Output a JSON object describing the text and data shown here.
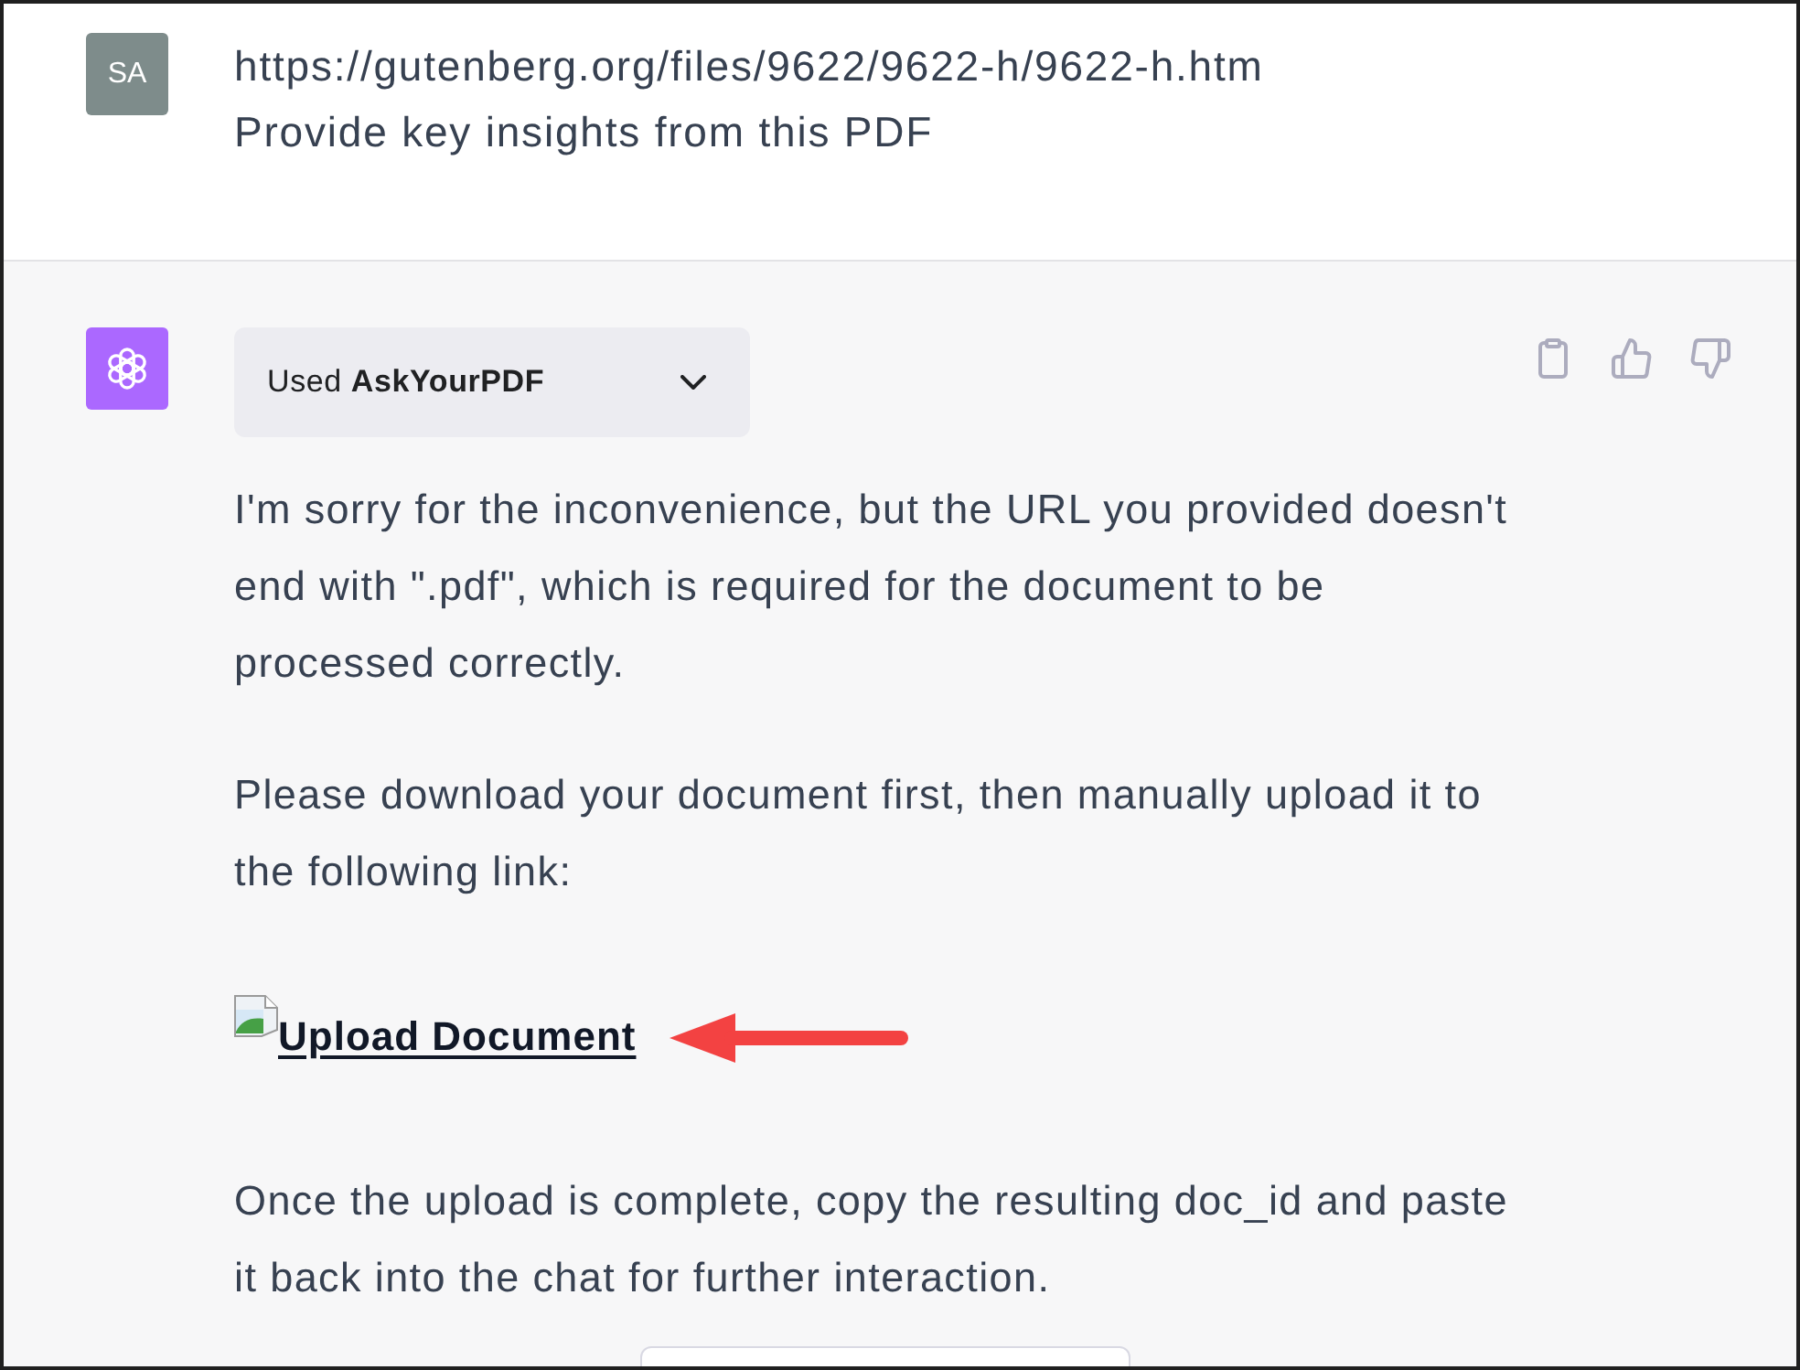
{
  "user_message": {
    "avatar": "SA",
    "lines": [
      "https://gutenberg.org/files/9622/9622-h/9622-h.htm",
      "Provide key insights from this PDF"
    ]
  },
  "assistant_message": {
    "plugin": {
      "label": "Used **AskYourPDF**",
      "expanded": false
    },
    "content": [
      {
        "kind": "paragraph",
        "text": "I'm sorry for the inconvenience, but the URL you provided doesn't end with \".pdf\", which is required for the document to be processed correctly."
      },
      {
        "kind": "paragraph",
        "text": "Please download your document first, then manually upload it to the following link:"
      },
      {
        "kind": "image_link",
        "text": "Upload Document"
      },
      {
        "kind": "paragraph",
        "text": "Once the upload is complete, copy the resulting doc_id and paste it back into the chat for further interaction."
      }
    ]
  }
}
